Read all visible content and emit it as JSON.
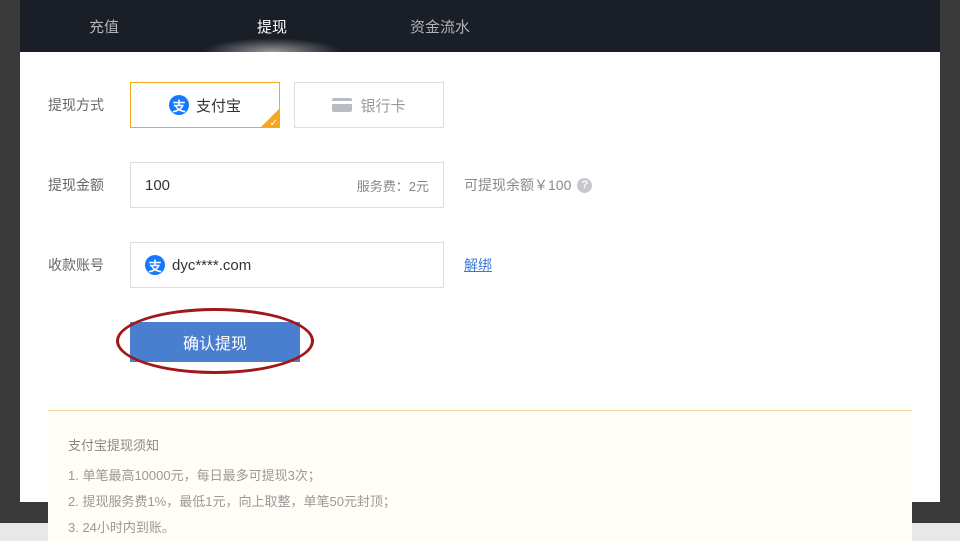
{
  "tabs": {
    "recharge": "充值",
    "withdraw": "提现",
    "flow": "资金流水"
  },
  "labels": {
    "method": "提现方式",
    "amount": "提现金额",
    "account": "收款账号"
  },
  "methods": {
    "alipay": "支付宝",
    "bankcard": "银行卡"
  },
  "amount": {
    "value": "100",
    "fee": "服务费：2元",
    "balance": "可提现余额￥100"
  },
  "account": {
    "value": "dyc****.com",
    "unbind": "解绑"
  },
  "submit": "确认提现",
  "notice": {
    "title": "支付宝提现须知",
    "l1": "1. 单笔最高10000元，每日最多可提现3次；",
    "l2": "2. 提现服务费1%，最低1元，向上取整，单笔50元封顶；",
    "l3": "3. 24小时内到账。"
  }
}
